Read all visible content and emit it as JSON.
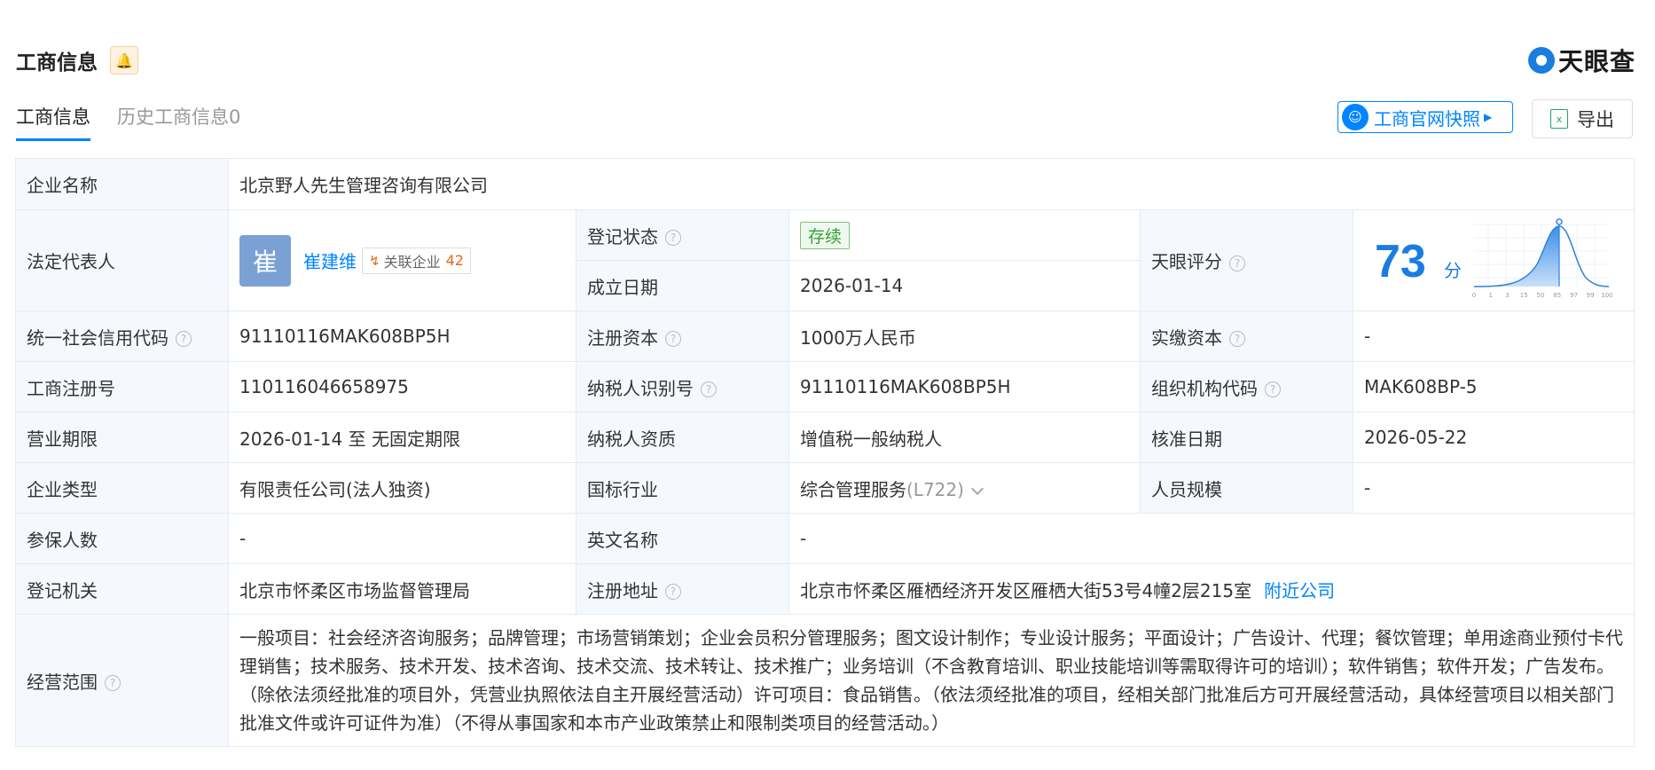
{
  "header": {
    "title": "工商信息",
    "logo_text": "天眼查"
  },
  "tabs": [
    {
      "label": "工商信息"
    },
    {
      "label": "历史工商信息0"
    }
  ],
  "actions": {
    "snapshot_label": "工商官网快照",
    "export_label": "导出"
  },
  "rows": {
    "company_name": {
      "label": "企业名称",
      "value": "北京野人先生管理咨询有限公司"
    },
    "legal_rep": {
      "label": "法定代表人",
      "avatar_char": "崔",
      "name": "崔建维",
      "related_label": "关联企业",
      "related_count": "42"
    },
    "reg_status": {
      "label": "登记状态",
      "value": "存续"
    },
    "found_date": {
      "label": "成立日期",
      "value": "2026-01-14"
    },
    "score": {
      "label": "天眼评分",
      "value": "73",
      "unit": "分",
      "axis_ticks": [
        "0",
        "1",
        "3",
        "15",
        "50",
        "85",
        "97",
        "99",
        "100"
      ]
    },
    "credit_code": {
      "label": "统一社会信用代码",
      "value": "91110116MAK608BP5H"
    },
    "reg_capital": {
      "label": "注册资本",
      "value": "1000万人民币"
    },
    "paid_capital": {
      "label": "实缴资本",
      "value": "-"
    },
    "reg_no": {
      "label": "工商注册号",
      "value": "110116046658975"
    },
    "taxpayer_id": {
      "label": "纳税人识别号",
      "value": "91110116MAK608BP5H"
    },
    "org_code": {
      "label": "组织机构代码",
      "value": "MAK608BP-5"
    },
    "term": {
      "label": "营业期限",
      "value": "2026-01-14 至 无固定期限"
    },
    "taxpayer_qual": {
      "label": "纳税人资质",
      "value": "增值税一般纳税人"
    },
    "approve_date": {
      "label": "核准日期",
      "value": "2026-05-22"
    },
    "company_type": {
      "label": "企业类型",
      "value": "有限责任公司(法人独资)"
    },
    "industry": {
      "label": "国标行业",
      "value": "综合管理服务",
      "code": "(L722)"
    },
    "staff_size": {
      "label": "人员规模",
      "value": "-"
    },
    "insured": {
      "label": "参保人数",
      "value": "-"
    },
    "english_name": {
      "label": "英文名称",
      "value": "-"
    },
    "reg_authority": {
      "label": "登记机关",
      "value": "北京市怀柔区市场监督管理局"
    },
    "reg_address": {
      "label": "注册地址",
      "value": "北京市怀柔区雁栖经济开发区雁栖大街53号4幢2层215室",
      "link": "附近公司"
    },
    "scope": {
      "label": "经营范围",
      "value": "一般项目：社会经济咨询服务；品牌管理；市场营销策划；企业会员积分管理服务；图文设计制作；专业设计服务；平面设计；广告设计、代理；餐饮管理；单用途商业预付卡代理销售；技术服务、技术开发、技术咨询、技术交流、技术转让、技术推广；业务培训（不含教育培训、职业技能培训等需取得许可的培训）；软件销售；软件开发；广告发布。（除依法须经批准的项目外，凭营业执照依法自主开展经营活动）许可项目：食品销售。（依法须经批准的项目，经相关部门批准后方可开展经营活动，具体经营项目以相关部门批准文件或许可证件为准）（不得从事国家和本市产业政策禁止和限制类项目的经营活动。）"
    }
  },
  "colors": {
    "accent": "#0084ff",
    "status_green": "#35a03a",
    "label_bg": "#f5f9fe"
  }
}
